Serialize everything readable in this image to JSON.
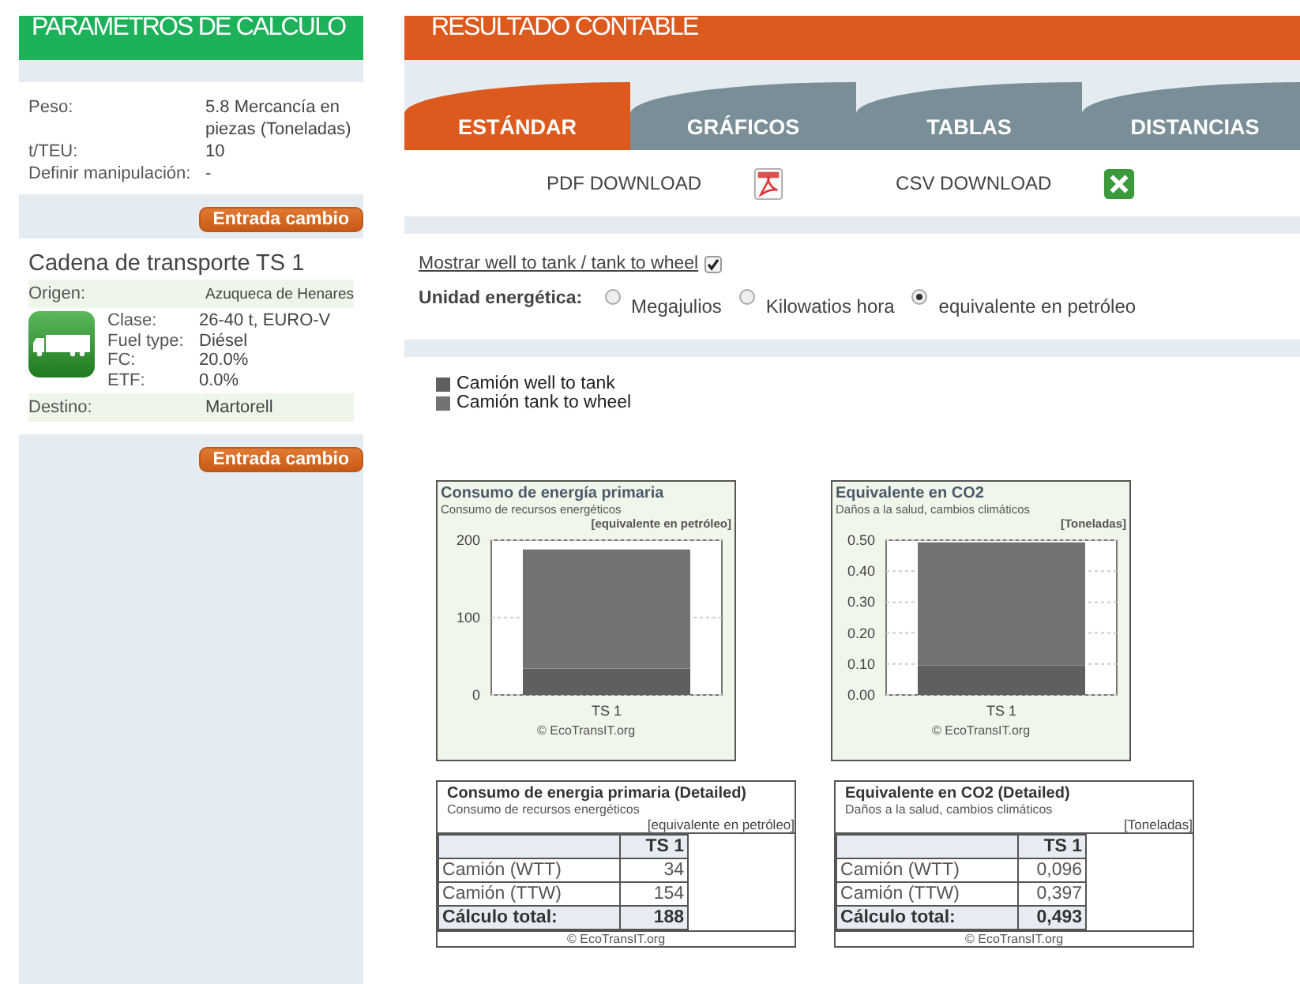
{
  "params": {
    "title": "PARAMETROS DE CALCULO",
    "fields": [
      {
        "label": "Peso:",
        "value": "5.8 Mercancía en piezas (Toneladas)"
      },
      {
        "label": "t/TEU:",
        "value": "10"
      },
      {
        "label": "Definir manipulación:",
        "value": "-"
      }
    ],
    "change_button": "Entrada cambio"
  },
  "chain": {
    "title": "Cadena de transporte TS 1",
    "origin_label": "Origen:",
    "origin": "Azuqueca de Henares",
    "details": [
      {
        "label": "Clase:",
        "value": "26-40 t, EURO-V"
      },
      {
        "label": "Fuel type:",
        "value": "Diésel"
      },
      {
        "label": "FC:",
        "value": "20.0%"
      },
      {
        "label": "ETF:",
        "value": "0.0%"
      }
    ],
    "destination_label": "Destino:",
    "destination": "Martorell",
    "change_button": "Entrada cambio"
  },
  "results": {
    "title": "RESULTADO CONTABLE",
    "tabs": [
      {
        "label": "ESTÁNDAR",
        "selected": true
      },
      {
        "label": "GRÁFICOS",
        "selected": false
      },
      {
        "label": "TABLAS",
        "selected": false
      },
      {
        "label": "DISTANCIAS",
        "selected": false
      }
    ],
    "downloads": [
      {
        "label": "PDF DOWNLOAD",
        "kind": "pdf"
      },
      {
        "label": "CSV DOWNLOAD",
        "kind": "excel"
      }
    ],
    "show_wtt": {
      "label": "Mostrar well to tank / tank to wheel",
      "checked": true
    },
    "unit_label": "Unidad energética:",
    "units": [
      {
        "label": "Megajulios",
        "selected": false
      },
      {
        "label": "Kilowatios hora",
        "selected": false
      },
      {
        "label": "equivalente en petróleo",
        "selected": true
      }
    ],
    "legend": [
      {
        "name": "Camión well to tank",
        "color": "#5f5f5f"
      },
      {
        "name": "Camión tank to wheel",
        "color": "#737373"
      }
    ],
    "charts": [
      {
        "subtitle": "Consumo de recursos energéticos",
        "unit": "[equivalente en petróleo]",
        "credit": "© EcoTransIT.org",
        "chart_data": {
          "type": "bar",
          "stacked": true,
          "title": "Consumo de energía primaria",
          "categories": [
            "TS 1"
          ],
          "series": [
            {
              "color": "#5f5f5f",
              "values": [
                34
              ]
            },
            {
              "color": "#737373",
              "values": [
                154
              ]
            }
          ],
          "grid": true,
          "ylim": [
            0,
            200
          ],
          "yticks": [
            0,
            100,
            200
          ]
        }
      },
      {
        "subtitle": "Daños a la salud, cambios climáticos",
        "unit": "[Toneladas]",
        "credit": "© EcoTransIT.org",
        "chart_data": {
          "type": "bar",
          "stacked": true,
          "title": "Equivalente en CO2",
          "categories": [
            "TS 1"
          ],
          "series": [
            {
              "color": "#5f5f5f",
              "values": [
                0.096
              ]
            },
            {
              "color": "#737373",
              "values": [
                0.397
              ]
            }
          ],
          "grid": true,
          "ylim": [
            0,
            0.5
          ],
          "yticks": [
            {
              "value": 0,
              "label": "0.00"
            },
            {
              "value": 0.1,
              "label": "0.10"
            },
            {
              "value": 0.2,
              "label": "0.20"
            },
            {
              "value": 0.3,
              "label": "0.30"
            },
            {
              "value": 0.4,
              "label": "0.40"
            },
            {
              "value": 0.5,
              "label": "0.50"
            }
          ]
        }
      }
    ],
    "tables": [
      {
        "title": "Consumo de energia primaria (Detailed)",
        "subtitle": "Consumo de recursos energéticos",
        "unit": "[equivalente en petróleo]",
        "column": "TS 1",
        "rows": [
          {
            "label": "Camión (WTT)",
            "value": "34",
            "total": false
          },
          {
            "label": "Camión (TTW)",
            "value": "154",
            "total": false
          },
          {
            "label": "Cálculo total:",
            "value": "188",
            "total": true
          }
        ],
        "credit": "© EcoTransIT.org"
      },
      {
        "title": "Equivalente en CO2 (Detailed)",
        "subtitle": "Daños a la salud, cambios climáticos",
        "unit": "[Toneladas]",
        "column": "TS 1",
        "rows": [
          {
            "label": "Camión (WTT)",
            "value": "0,096",
            "total": false
          },
          {
            "label": "Camión (TTW)",
            "value": "0,397",
            "total": false
          },
          {
            "label": "Cálculo total:",
            "value": "0,493",
            "total": true
          }
        ],
        "credit": "© EcoTransIT.org"
      }
    ]
  }
}
